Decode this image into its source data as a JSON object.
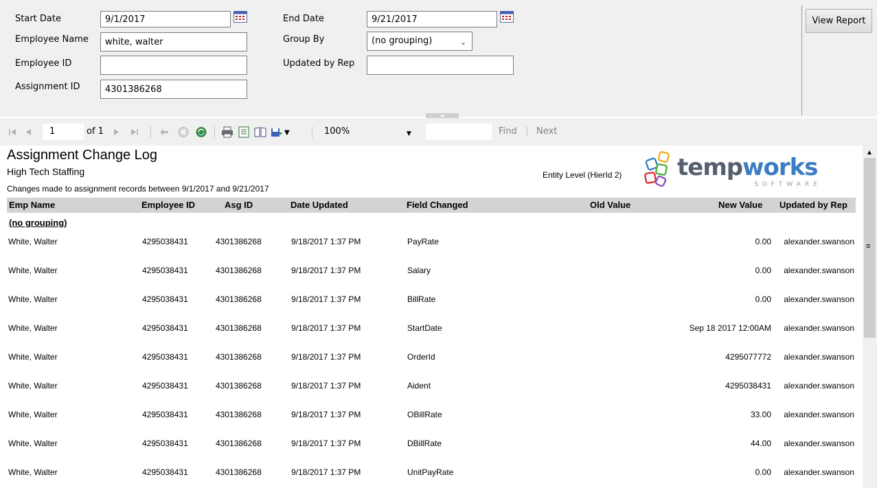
{
  "params": {
    "start_date_label": "Start Date",
    "start_date_value": "9/1/2017",
    "end_date_label": "End Date",
    "end_date_value": "9/21/2017",
    "employee_name_label": "Employee Name",
    "employee_name_value": "white, walter",
    "group_by_label": "Group By",
    "group_by_value": "(no grouping)",
    "employee_id_label": "Employee ID",
    "employee_id_value": "",
    "updated_by_rep_label": "Updated by Rep",
    "updated_by_rep_value": "",
    "assignment_id_label": "Assignment ID",
    "assignment_id_value": "4301386268",
    "view_report_label": "View Report"
  },
  "toolbar": {
    "page_current": "1",
    "page_of": "of 1",
    "zoom": "100%",
    "find_label": "Find",
    "separator": "|",
    "next_label": "Next"
  },
  "icons": {
    "first": "first-page-icon",
    "prev": "prev-page-icon",
    "next": "next-page-icon",
    "last": "last-page-icon",
    "back": "back-icon",
    "stop": "stop-icon",
    "refresh": "refresh-icon",
    "print": "print-icon",
    "layout": "print-layout-icon",
    "page_setup": "page-setup-icon",
    "export": "export-icon",
    "calendar": "calendar-icon"
  },
  "report": {
    "title": "Assignment Change Log",
    "company": "High Tech Staffing",
    "description": "Changes made to assignment records between 9/1/2017 and 9/21/2017",
    "entity_level": "Entity Level (HierId 2)",
    "logo_word_a": "temp",
    "logo_word_b": "works",
    "logo_sub": "SOFTWARE",
    "columns": {
      "emp_name": "Emp Name",
      "employee_id": "Employee ID",
      "asg_id": "Asg ID",
      "date_updated": "Date Updated",
      "field_changed": "Field Changed",
      "old_value": "Old Value",
      "new_value": "New Value",
      "updated_by_rep": "Updated by Rep"
    },
    "group_label": "(no grouping)",
    "rows": [
      {
        "emp_name": "White, Walter",
        "employee_id": "4295038431",
        "asg_id": "4301386268",
        "date_updated": "9/18/2017 1:37 PM",
        "field_changed": "PayRate",
        "old_value": "",
        "new_value": "0.00",
        "updated_by_rep": "alexander.swanson"
      },
      {
        "emp_name": "White, Walter",
        "employee_id": "4295038431",
        "asg_id": "4301386268",
        "date_updated": "9/18/2017 1:37 PM",
        "field_changed": "Salary",
        "old_value": "",
        "new_value": "0.00",
        "updated_by_rep": "alexander.swanson"
      },
      {
        "emp_name": "White, Walter",
        "employee_id": "4295038431",
        "asg_id": "4301386268",
        "date_updated": "9/18/2017 1:37 PM",
        "field_changed": "BillRate",
        "old_value": "",
        "new_value": "0.00",
        "updated_by_rep": "alexander.swanson"
      },
      {
        "emp_name": "White, Walter",
        "employee_id": "4295038431",
        "asg_id": "4301386268",
        "date_updated": "9/18/2017 1:37 PM",
        "field_changed": "StartDate",
        "old_value": "",
        "new_value": "Sep 18 2017 12:00AM",
        "updated_by_rep": "alexander.swanson"
      },
      {
        "emp_name": "White, Walter",
        "employee_id": "4295038431",
        "asg_id": "4301386268",
        "date_updated": "9/18/2017 1:37 PM",
        "field_changed": "OrderId",
        "old_value": "",
        "new_value": "4295077772",
        "updated_by_rep": "alexander.swanson"
      },
      {
        "emp_name": "White, Walter",
        "employee_id": "4295038431",
        "asg_id": "4301386268",
        "date_updated": "9/18/2017 1:37 PM",
        "field_changed": "Aident",
        "old_value": "",
        "new_value": "4295038431",
        "updated_by_rep": "alexander.swanson"
      },
      {
        "emp_name": "White, Walter",
        "employee_id": "4295038431",
        "asg_id": "4301386268",
        "date_updated": "9/18/2017 1:37 PM",
        "field_changed": "OBillRate",
        "old_value": "",
        "new_value": "33.00",
        "updated_by_rep": "alexander.swanson"
      },
      {
        "emp_name": "White, Walter",
        "employee_id": "4295038431",
        "asg_id": "4301386268",
        "date_updated": "9/18/2017 1:37 PM",
        "field_changed": "DBillRate",
        "old_value": "",
        "new_value": "44.00",
        "updated_by_rep": "alexander.swanson"
      },
      {
        "emp_name": "White, Walter",
        "employee_id": "4295038431",
        "asg_id": "4301386268",
        "date_updated": "9/18/2017 1:37 PM",
        "field_changed": "UnitPayRate",
        "old_value": "",
        "new_value": "0.00",
        "updated_by_rep": "alexander.swanson"
      }
    ]
  }
}
